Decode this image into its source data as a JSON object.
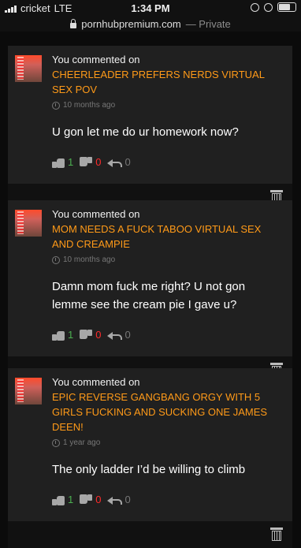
{
  "status": {
    "carrier": "cricket",
    "network": "LTE",
    "time": "1:34 PM"
  },
  "browser": {
    "url": "pornhubpremium.com",
    "private": "— Private"
  },
  "cards": [
    {
      "header": "You commented on",
      "video": "CHEERLEADER PREFERS NERDS VIRTUAL SEX POV",
      "time": "10 months ago",
      "comment": "U gon let me do ur homework now?",
      "likes": "1",
      "dislikes": "0",
      "replies": "0"
    },
    {
      "header": "You commented on",
      "video": "MOM NEEDS A FUCK TABOO VIRTUAL SEX AND CREAMPIE",
      "time": "10 months ago",
      "comment": "Damn mom fuck me right? U not gon lemme see the cream pie I gave u?",
      "likes": "1",
      "dislikes": "0",
      "replies": "0"
    },
    {
      "header": "You commented on",
      "video": "EPIC REVERSE GANGBANG ORGY WITH 5 GIRLS FUCKING AND SUCKING ONE JAMES DEEN!",
      "time": "1 year ago",
      "comment": "The only ladder I’d be willing to climb",
      "likes": "1",
      "dislikes": "0",
      "replies": "0"
    }
  ],
  "icons": {
    "like": "thumbs-up-icon",
    "dislike": "thumbs-down-icon",
    "reply": "reply-icon",
    "delete": "trash-icon",
    "time": "clock-icon"
  }
}
